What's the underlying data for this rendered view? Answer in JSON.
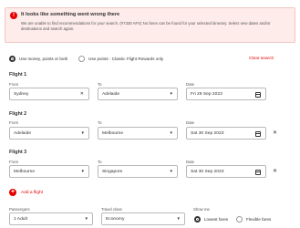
{
  "alert": {
    "title": "It looks like something went wrong there",
    "message": "We are unable to find recommendations for your search. (#7330 AFX) No fares can be found for your selected itinerary. Select new dates and/or destinations and search again."
  },
  "payment": {
    "option_money": "Use money, points or both",
    "option_points": "Use points - Classic Flight Rewards only",
    "selected": "money"
  },
  "clear_label": "Clear search",
  "field_labels": {
    "from": "From",
    "to": "To",
    "date": "Date"
  },
  "flights": [
    {
      "heading": "Flight 1",
      "from": "Sydney",
      "to": "Adelaide",
      "date": "Fri 29 Sep 2023"
    },
    {
      "heading": "Flight 2",
      "from": "Adelaide",
      "to": "Melbourne",
      "date": "Sat 30 Sep 2023"
    },
    {
      "heading": "Flight 3",
      "from": "Melbourne",
      "to": "Singapore",
      "date": "Sat 30 Sep 2023"
    }
  ],
  "add_flight_label": "Add a flight",
  "bottom": {
    "passengers_label": "Passengers",
    "passengers_value": "1 Adult",
    "class_label": "Travel class",
    "class_value": "Economy",
    "show_label": "Show me",
    "lowest": "Lowest fares",
    "flexible": "Flexible fares",
    "selected": "lowest"
  },
  "icons": {
    "alert": "warning-icon",
    "clear": "close-icon",
    "dropdown": "chevron-down-icon",
    "calendar": "calendar-icon",
    "remove": "close-icon",
    "add": "plus-icon"
  },
  "colors": {
    "accent": "#e40000",
    "alert_bg": "#fdecea",
    "text": "#323232"
  }
}
